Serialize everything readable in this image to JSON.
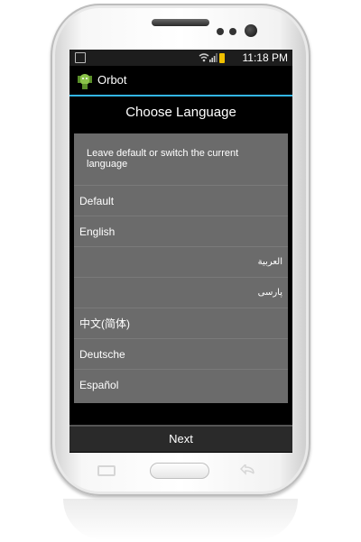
{
  "status_bar": {
    "time": "11:18 PM",
    "icons": [
      "image-icon",
      "wifi-icon",
      "signal-icon",
      "battery-icon"
    ],
    "battery_color": "#f0c000"
  },
  "app_bar": {
    "title": "Orbot",
    "accent_color": "#33b5e5"
  },
  "wizard": {
    "title": "Choose Language",
    "instructions": "Leave default or switch the current language",
    "languages": [
      {
        "label": "Default"
      },
      {
        "label": "English"
      },
      {
        "label": "العربية"
      },
      {
        "label": "پارسی"
      },
      {
        "label": "中文(简体)"
      },
      {
        "label": "Deutsche"
      },
      {
        "label": "Español"
      }
    ],
    "next_label": "Next"
  }
}
